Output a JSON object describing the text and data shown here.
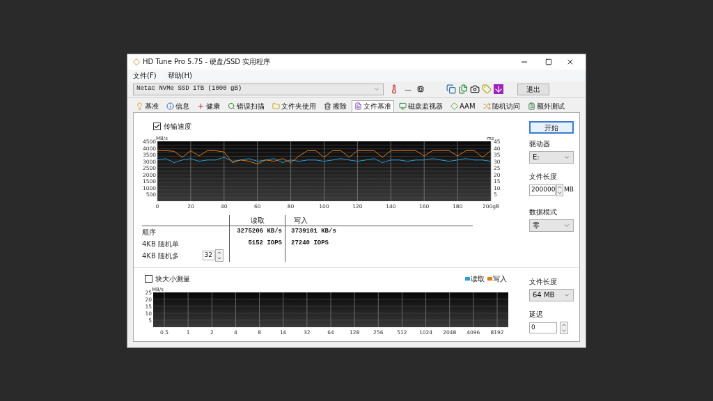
{
  "window": {
    "title": "HD Tune Pro 5.75 - 硬盘/SSD 实用程序"
  },
  "menu": [
    "文件(F)",
    "帮助(H)"
  ],
  "toolbar": {
    "drive": "Netac NVMe SSD 1TB (1000 gB)",
    "temperature": "—",
    "exit_button": "退出"
  },
  "tabs": [
    {
      "label": "基准",
      "selected": false
    },
    {
      "label": "信息",
      "selected": false
    },
    {
      "label": "健康",
      "selected": false
    },
    {
      "label": "错误扫描",
      "selected": false
    },
    {
      "label": "文件夹使用",
      "selected": false
    },
    {
      "label": "擦除",
      "selected": false
    },
    {
      "label": "文件基准",
      "selected": true
    },
    {
      "label": "磁盘监视器",
      "selected": false
    },
    {
      "label": "AAM",
      "selected": false
    },
    {
      "label": "随机访问",
      "selected": false
    },
    {
      "label": "额外测试",
      "selected": false
    }
  ],
  "transfer": {
    "checkbox": {
      "label": "传输速度",
      "checked": true
    },
    "chart_data": {
      "type": "line",
      "ylabel": "MB/s",
      "y2label": "ms",
      "x": [
        0,
        5,
        10,
        15,
        20,
        25,
        30,
        35,
        40,
        45,
        50,
        55,
        60,
        65,
        70,
        75,
        80,
        85,
        90,
        95,
        100,
        105,
        110,
        115,
        120,
        125,
        130,
        135,
        140,
        145,
        150,
        155,
        160,
        165,
        170,
        175,
        180,
        185,
        190,
        195,
        200
      ],
      "xticks": [
        0,
        20,
        40,
        60,
        80,
        100,
        120,
        140,
        160,
        180,
        {
          "value": 200,
          "label": "200gB"
        }
      ],
      "xlim": [
        0,
        200
      ],
      "ylim": [
        0,
        4500
      ],
      "yticks": [
        500,
        1000,
        1500,
        2000,
        2500,
        3000,
        3500,
        4000,
        4500
      ],
      "y2ticks": [
        5,
        10,
        15,
        20,
        25,
        30,
        35,
        40,
        45
      ],
      "y2lim": [
        0,
        45
      ],
      "grid": true,
      "series": [
        {
          "color": "#2a9fd6",
          "values": [
            3100,
            3200,
            2900,
            3100,
            3200,
            3000,
            3100,
            3100,
            3300,
            3000,
            3100,
            3200,
            3000,
            3100,
            3200,
            2900,
            3100,
            3000,
            3100,
            3100,
            3000,
            3100,
            3200,
            3100,
            3000,
            3100,
            3200,
            2900,
            3100,
            3100,
            3000,
            3100,
            3100,
            3200,
            3100,
            3000,
            3100,
            3200,
            3100,
            3100,
            3000
          ]
        },
        {
          "color": "#e07b1a",
          "values": [
            3800,
            3800,
            3750,
            3300,
            3800,
            3400,
            3800,
            3800,
            3700,
            2900,
            3100,
            3000,
            2800,
            3100,
            3000,
            3200,
            2900,
            3400,
            3800,
            3800,
            3300,
            3800,
            3800,
            3300,
            3800,
            3800,
            3800,
            3300,
            3800,
            3800,
            3800,
            3800,
            3400,
            3800,
            3800,
            3800,
            3400,
            3800,
            3800,
            3300,
            3800
          ]
        }
      ]
    },
    "table": {
      "columns": [
        "读取",
        "写入"
      ],
      "rows": [
        {
          "label": "顺序",
          "read": "3275206 KB/s",
          "write": "3739101 KB/s"
        },
        {
          "label": "4KB 随机单",
          "read": "5152 IOPS",
          "write": "27240 IOPS"
        },
        {
          "label": "4KB 随机多",
          "queue_depth": "32"
        }
      ]
    }
  },
  "side": {
    "start_button": "开始",
    "drive_label": "驱动器",
    "drive": "E:",
    "file_length_label": "文件长度",
    "file_length": "200000",
    "file_length_unit": "MB",
    "data_mode_label": "数据模式",
    "data_mode": "零"
  },
  "block": {
    "checkbox": {
      "label": "块大小测量",
      "checked": false
    },
    "chart_data": {
      "type": "line",
      "ylabel": "MB/s",
      "categories": [
        "0.5",
        "1",
        "2",
        "4",
        "8",
        "16",
        "32",
        "64",
        "128",
        "256",
        "512",
        "1024",
        "2048",
        "4096",
        "8192"
      ],
      "ylim": [
        0,
        25
      ],
      "yticks": [
        5,
        10,
        15,
        20,
        25
      ],
      "grid": true,
      "series": [
        {
          "name": "读取",
          "color": "#2a9fd6",
          "values": [
            null,
            null,
            null,
            null,
            null,
            null,
            null,
            null,
            null,
            null,
            null,
            null,
            null,
            null,
            null
          ]
        },
        {
          "name": "写入",
          "color": "#e07b1a",
          "values": [
            null,
            null,
            null,
            null,
            null,
            null,
            null,
            null,
            null,
            null,
            null,
            null,
            null,
            null,
            null
          ]
        }
      ]
    }
  },
  "block_side": {
    "file_length_label": "文件长度",
    "file_length": "64 MB",
    "delay_label": "延迟",
    "delay": "0"
  }
}
